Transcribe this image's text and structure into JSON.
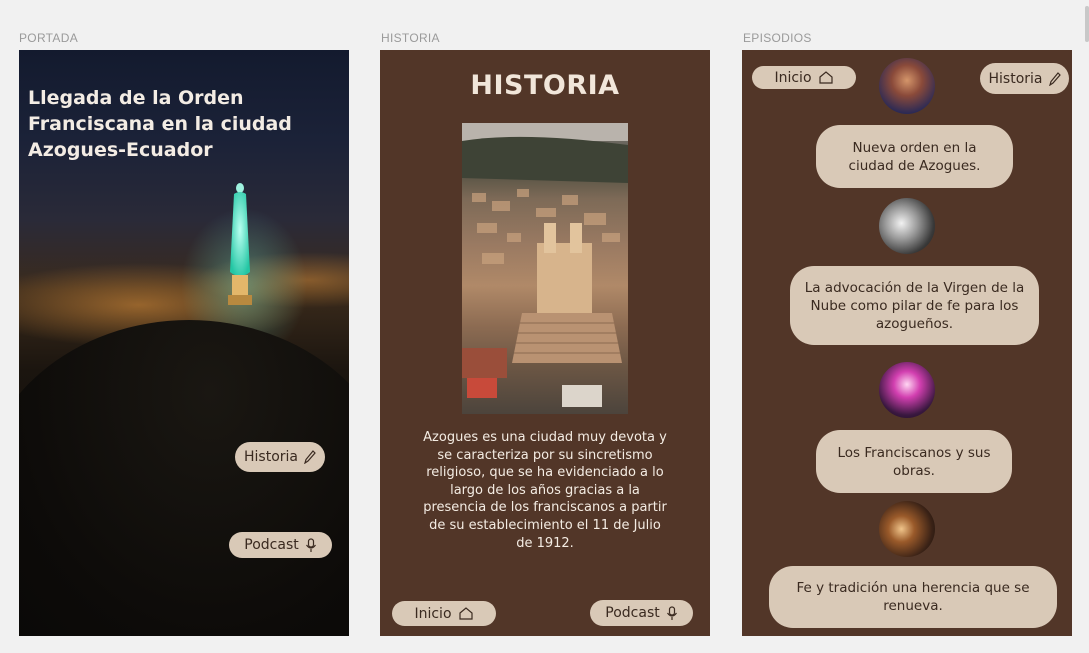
{
  "frames": {
    "portada": {
      "label": "PORTADA",
      "title": "Llegada de la Orden Franciscana en la ciudad Azogues-Ecuador",
      "historia_button": "Historia",
      "podcast_button": "Podcast"
    },
    "historia": {
      "label": "HISTORIA",
      "title": "HISTORIA",
      "body": "Azogues es una ciudad muy devota y se caracteriza por su sincretismo religioso, que se ha evidenciado a lo largo de los años gracias a la presencia de los franciscanos a partir de su establecimiento el 11 de Julio de 1912.",
      "inicio_button": "Inicio",
      "podcast_button": "Podcast"
    },
    "episodios": {
      "label": "EPISODIOS",
      "inicio_button": "Inicio",
      "historia_button": "Historia",
      "episodes": [
        {
          "title": "Nueva orden en la ciudad de Azogues."
        },
        {
          "title": "La advocación de la Virgen de la Nube como pilar de fe para los azogueños."
        },
        {
          "title": "Los Franciscanos y sus obras."
        },
        {
          "title": "Fe y tradición una herencia que se renueva."
        }
      ]
    }
  },
  "colors": {
    "frame_brown": "#523628",
    "pill_beige": "#d9c9b7",
    "pill_text": "#3a2a20",
    "canvas": "#f1f1f1"
  },
  "icons": [
    "pencil-icon",
    "microphone-icon",
    "home-icon"
  ]
}
